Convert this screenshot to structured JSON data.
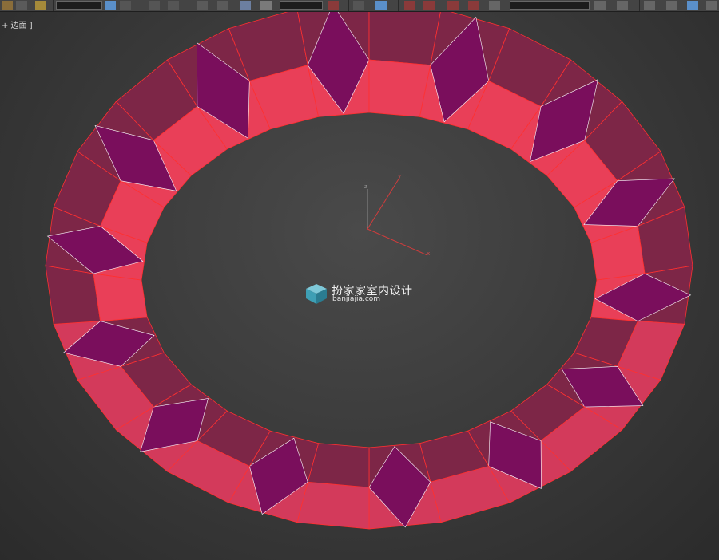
{
  "viewport": {
    "label": "+ 边面 ]"
  },
  "gizmo": {
    "z_label": "z",
    "y_label": "y",
    "x_label": "x"
  },
  "watermark": {
    "title": "扮家家室内设计",
    "url": "banjiajia.com"
  },
  "colors": {
    "toolbar_bg": "#444444",
    "viewport_bg": "#2b2b2b",
    "ring_outer": "#7d2647",
    "ring_front": "#d33a5b",
    "ring_inner": "#e93f58",
    "ring_edge": "#ff3030",
    "notch": "#7a0e5c",
    "active_button": "#5a8fc9"
  },
  "icons": [
    "undo-icon",
    "link-icon",
    "select-object-icon",
    "select-region-icon",
    "move-icon",
    "rotate-icon",
    "snap-icon",
    "mirror-icon",
    "align-icon",
    "text-abc-icon",
    "layer-icon"
  ]
}
